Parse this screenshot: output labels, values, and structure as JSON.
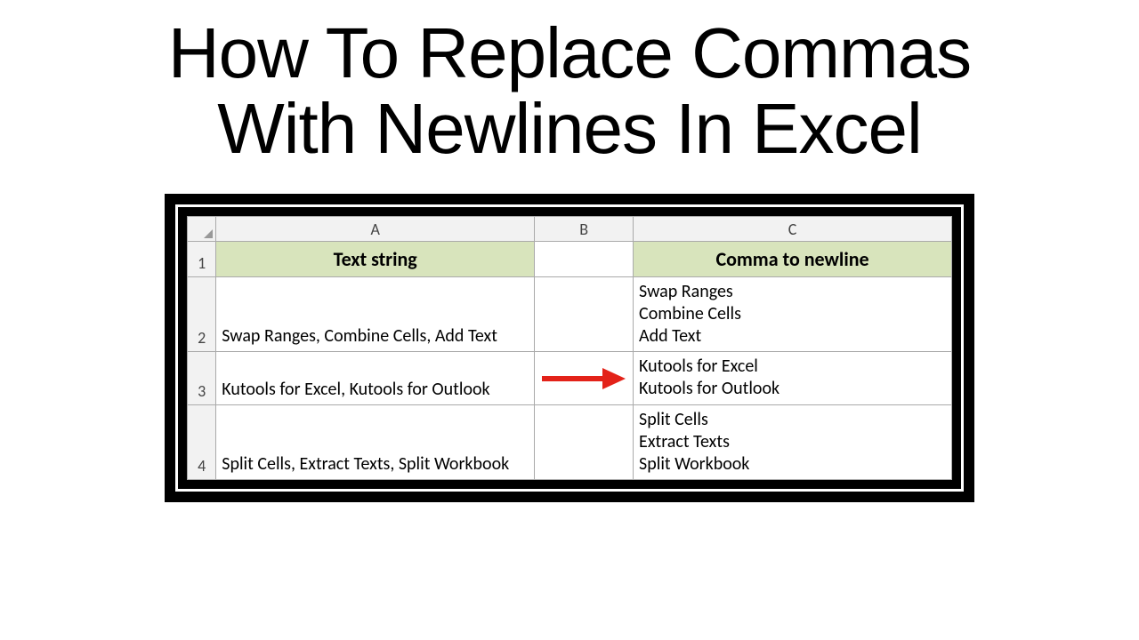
{
  "title": {
    "line1": "How To Replace Commas",
    "line2": "With Newlines In Excel"
  },
  "columns": {
    "a": "A",
    "b": "B",
    "c": "C"
  },
  "row_nums": {
    "r1": "1",
    "r2": "2",
    "r3": "3",
    "r4": "4"
  },
  "headers": {
    "a": "Text string",
    "c": "Comma to newline"
  },
  "cells": {
    "a2": "Swap Ranges, Combine Cells, Add Text",
    "c2": "Swap Ranges\nCombine Cells\n Add Text",
    "a3": "Kutools for Excel, Kutools for Outlook",
    "c3": "Kutools for Excel\nKutools for Outlook",
    "a4": "Split Cells, Extract Texts, Split Workbook",
    "c4": "Split Cells\nExtract Texts\nSplit Workbook"
  },
  "colors": {
    "header_fill": "#d8e4bc",
    "arrow": "#e32219"
  }
}
